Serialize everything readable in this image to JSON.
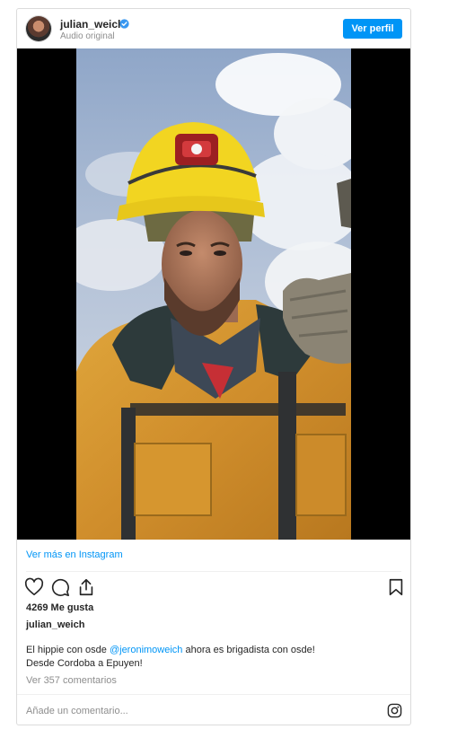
{
  "header": {
    "username": "julian_weich",
    "subtitle": "Audio original",
    "profile_button": "Ver perfil"
  },
  "colors": {
    "accent": "#0095f6",
    "text": "#262626",
    "muted": "#8e8e8e",
    "border": "#dbdbdb"
  },
  "media": {
    "type": "video",
    "icons": [
      "verified-badge-icon"
    ]
  },
  "links": {
    "see_more": "Ver más en Instagram"
  },
  "actions": {
    "icons": [
      "heart-icon",
      "comment-icon",
      "share-icon",
      "bookmark-icon"
    ]
  },
  "post": {
    "likes": "4269 Me gusta",
    "owner": "julian_weich",
    "caption_prefix": "El hippie con osde ",
    "caption_mention": "@jeronimoweich",
    "caption_suffix": " ahora es brigadista con osde!",
    "caption_line2": "Desde Cordoba a Epuyen!",
    "comments_link": "Ver 357 comentarios"
  },
  "comment_box": {
    "placeholder": "Añade un comentario...",
    "icon": "instagram-icon"
  }
}
